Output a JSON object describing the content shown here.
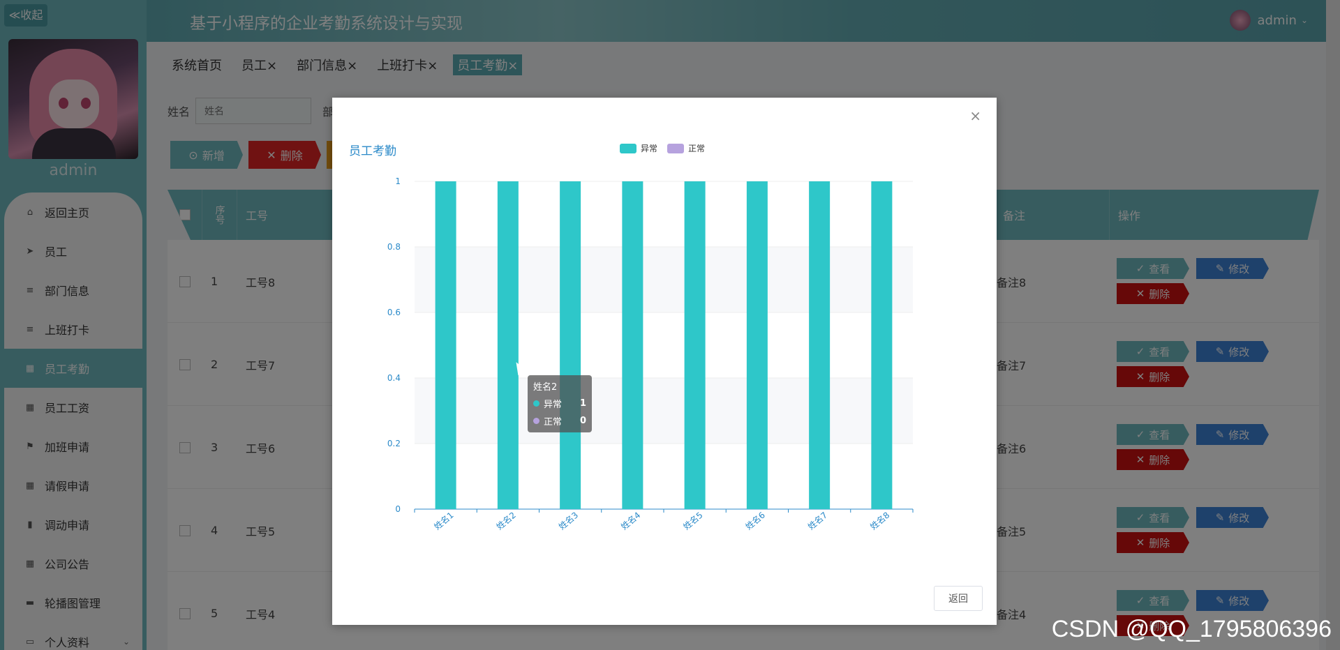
{
  "app": {
    "collapse_label": "≪收起",
    "title": "基于小程序的企业考勤系统设计与实现",
    "user_name": "admin",
    "sidebar_user": "admin"
  },
  "menu": [
    {
      "label": "返回主页",
      "icon": "home-icon",
      "glyph": "⌂"
    },
    {
      "label": "员工",
      "icon": "send-icon",
      "glyph": "➤"
    },
    {
      "label": "部门信息",
      "icon": "list-icon",
      "glyph": "≡"
    },
    {
      "label": "上班打卡",
      "icon": "list-icon",
      "glyph": "≡"
    },
    {
      "label": "员工考勤",
      "icon": "grid-icon",
      "glyph": "▦"
    },
    {
      "label": "员工工资",
      "icon": "grid-icon",
      "glyph": "▦"
    },
    {
      "label": "加班申请",
      "icon": "flag-icon",
      "glyph": "⚑"
    },
    {
      "label": "请假申请",
      "icon": "grid-icon",
      "glyph": "▦"
    },
    {
      "label": "调动申请",
      "icon": "chart-icon",
      "glyph": "▮"
    },
    {
      "label": "公司公告",
      "icon": "grid-icon",
      "glyph": "▦"
    },
    {
      "label": "轮播图管理",
      "icon": "film-icon",
      "glyph": "▬"
    },
    {
      "label": "个人资料",
      "icon": "profile-icon",
      "glyph": "▭"
    }
  ],
  "tabs": [
    "系统首页",
    "员工",
    "部门信息",
    "上班打卡",
    "员工考勤"
  ],
  "tab_close": "×",
  "search": {
    "label": "姓名",
    "placeholder": "姓名",
    "label2": "部"
  },
  "actions": {
    "add": "新增",
    "delete": "删除"
  },
  "table": {
    "headers": {
      "index": "序号",
      "job_no": "工号",
      "remark": "备注",
      "ops": "操作"
    },
    "rows": [
      {
        "index": "1",
        "job_no": "工号8",
        "remark": "备注8"
      },
      {
        "index": "2",
        "job_no": "工号7",
        "remark": "备注7"
      },
      {
        "index": "3",
        "job_no": "工号6",
        "remark": "备注6"
      },
      {
        "index": "4",
        "job_no": "工号5",
        "remark": "备注5"
      },
      {
        "index": "5",
        "job_no": "工号4",
        "remark": "备注4"
      }
    ],
    "ops": {
      "view": "查看",
      "edit": "修改",
      "delete": "删除"
    }
  },
  "modal": {
    "close": "×",
    "return_label": "返回",
    "tooltip": {
      "title": "姓名2",
      "rows": [
        {
          "name": "异常",
          "value": "1"
        },
        {
          "name": "正常",
          "value": "0"
        }
      ]
    }
  },
  "chart_data": {
    "type": "bar",
    "title": "员工考勤",
    "categories": [
      "姓名1",
      "姓名2",
      "姓名3",
      "姓名4",
      "姓名5",
      "姓名6",
      "姓名7",
      "姓名8"
    ],
    "series": [
      {
        "name": "异常",
        "values": [
          1,
          1,
          1,
          1,
          1,
          1,
          1,
          1
        ],
        "color": "#2ec7c9"
      },
      {
        "name": "正常",
        "values": [
          0,
          0,
          0,
          0,
          0,
          0,
          0,
          0
        ],
        "color": "#b6a2de"
      }
    ],
    "ylim": [
      0,
      1
    ],
    "yticks": [
      "0",
      "0.2",
      "0.4",
      "0.6",
      "0.8",
      "1"
    ],
    "legend_position": "top-center",
    "grid": true
  },
  "watermark": "CSDN @QQ_1795806396"
}
